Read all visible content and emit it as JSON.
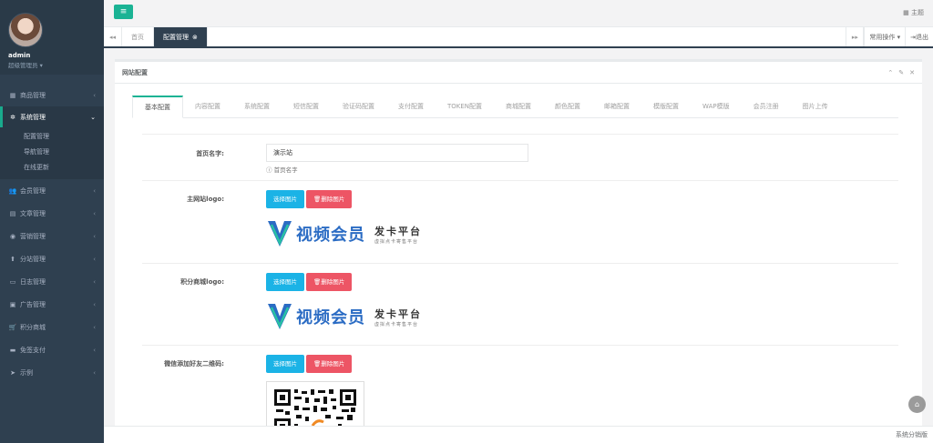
{
  "sidebar": {
    "user": {
      "name": "admin",
      "role": "超级管理员"
    },
    "items": [
      {
        "icon": "▦",
        "label": "商品管理",
        "expanded": false
      },
      {
        "icon": "✲",
        "label": "系统管理",
        "expanded": true,
        "children": [
          "配置管理",
          "导航管理",
          "在线更新"
        ]
      },
      {
        "icon": "👥",
        "label": "会员管理",
        "expanded": false
      },
      {
        "icon": "▤",
        "label": "文章管理",
        "expanded": false
      },
      {
        "icon": "◉",
        "label": "营销管理",
        "expanded": false
      },
      {
        "icon": "⬆",
        "label": "分站管理",
        "expanded": false
      },
      {
        "icon": "▭",
        "label": "日志管理",
        "expanded": false
      },
      {
        "icon": "▣",
        "label": "广告管理",
        "expanded": false
      },
      {
        "icon": "🛒",
        "label": "积分商城",
        "expanded": false
      },
      {
        "icon": "▬",
        "label": "免签支付",
        "expanded": false
      },
      {
        "icon": "➤",
        "label": "示例",
        "expanded": false
      }
    ]
  },
  "topbar": {
    "theme_label": "主题"
  },
  "tabs_strip": {
    "home": "首页",
    "active": "配置管理",
    "ops": "常用操作",
    "logout": "退出"
  },
  "card": {
    "title": "网站配置",
    "tabs": [
      "基本配置",
      "内容配置",
      "系统配置",
      "短信配置",
      "验证码配置",
      "支付配置",
      "TOKEN配置",
      "商城配置",
      "颜色配置",
      "邮箱配置",
      "模版配置",
      "WAP模版",
      "会员注册",
      "图片上传"
    ],
    "active_tab": 0
  },
  "form": {
    "site_name": {
      "label": "首页名字:",
      "value": "演示站",
      "help": "首页名字"
    },
    "main_logo": {
      "label": "主网站logo:"
    },
    "points_logo": {
      "label": "积分商城logo:"
    },
    "wechat_qr": {
      "label": "微信添加好友二维码:"
    },
    "select_btn": "选择图片",
    "delete_btn": "删除图片"
  },
  "logo_text": {
    "main": "视频会员",
    "side": "发卡平台",
    "tag": "虚拟点卡寄售平台"
  },
  "footer": {
    "text": "系统分销版"
  }
}
